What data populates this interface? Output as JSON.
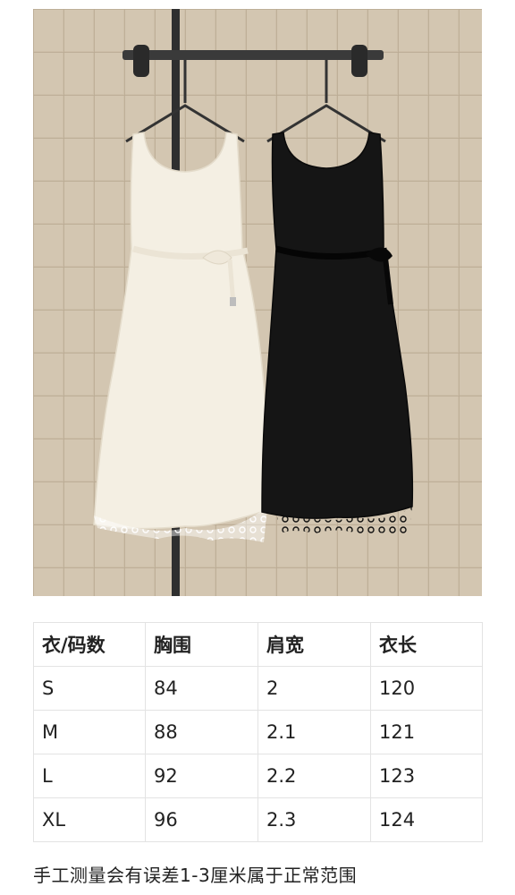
{
  "photo": {
    "alt_colors": {
      "wall": "#cdbfa9",
      "grout": "#b8a891",
      "rail": "#3a3a3a",
      "white_dress": "#f4efe3",
      "black_dress": "#151515"
    }
  },
  "size_table": {
    "headers": [
      "衣/码数",
      "胸围",
      "肩宽",
      "衣长"
    ],
    "rows": [
      [
        "S",
        "84",
        "2",
        "120"
      ],
      [
        "M",
        "88",
        "2.1",
        "121"
      ],
      [
        "L",
        "92",
        "2.2",
        "123"
      ],
      [
        "XL",
        "96",
        "2.3",
        "124"
      ]
    ]
  },
  "note": "手工测量会有误差1-3厘米属于正常范围"
}
